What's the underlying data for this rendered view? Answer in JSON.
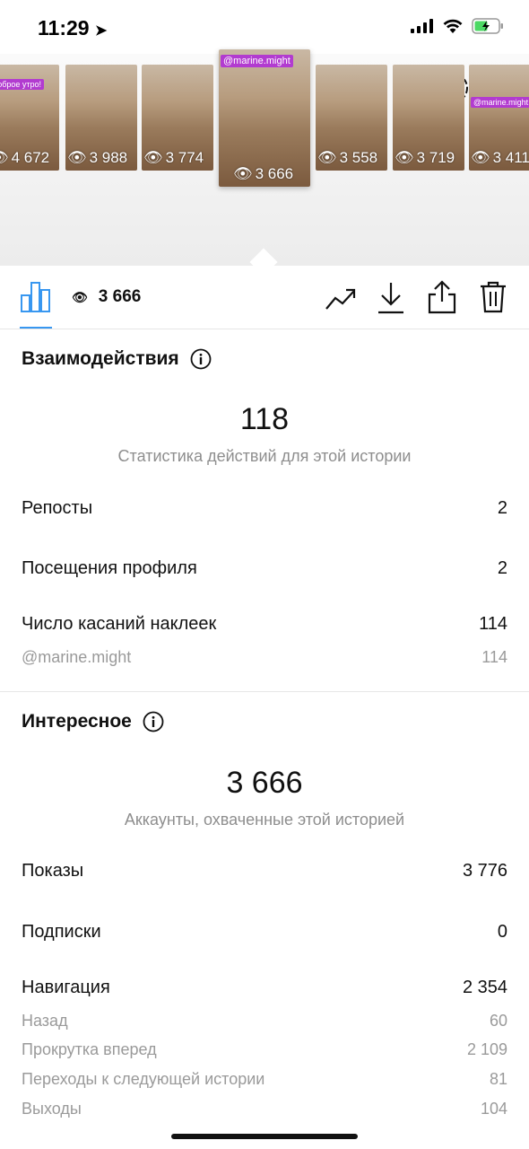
{
  "status": {
    "time": "11:29"
  },
  "thumbnails": [
    {
      "views": "4 672",
      "tag": "Доброе утро!"
    },
    {
      "views": "3 988",
      "tag": ""
    },
    {
      "views": "3 774",
      "tag": ""
    },
    {
      "views": "3 666",
      "tag": "@marine.might",
      "selected": true
    },
    {
      "views": "3 558",
      "tag": ""
    },
    {
      "views": "3 719",
      "tag": ""
    },
    {
      "views": "3 411",
      "tag": "@marine.might"
    }
  ],
  "toolbar": {
    "views": "3 666"
  },
  "interactions": {
    "title": "Взаимодействия",
    "total": "118",
    "caption": "Статистика действий для этой истории",
    "rows": [
      {
        "label": "Репосты",
        "value": "2"
      },
      {
        "label": "Посещения профиля",
        "value": "2"
      },
      {
        "label": "Число касаний наклеек",
        "value": "114"
      }
    ],
    "sub_rows": [
      {
        "label": "@marine.might",
        "value": "114"
      }
    ]
  },
  "discovery": {
    "title": "Интересное",
    "total": "3 666",
    "caption": "Аккаунты, охваченные этой историей",
    "rows": [
      {
        "label": "Показы",
        "value": "3 776"
      },
      {
        "label": "Подписки",
        "value": "0"
      },
      {
        "label": "Навигация",
        "value": "2 354"
      }
    ],
    "sub_rows": [
      {
        "label": "Назад",
        "value": "60"
      },
      {
        "label": "Прокрутка вперед",
        "value": "2 109"
      },
      {
        "label": "Переходы к следующей истории",
        "value": "81"
      },
      {
        "label": "Выходы",
        "value": "104"
      }
    ]
  }
}
